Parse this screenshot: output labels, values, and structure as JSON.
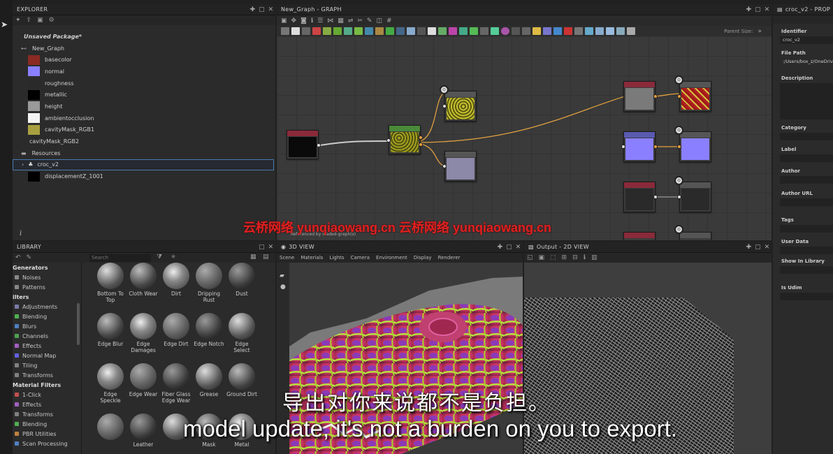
{
  "explorer": {
    "title": "EXPLORER",
    "package": "Unsaved Package*",
    "graph": "New_Graph",
    "outputs": [
      {
        "label": "basecolor",
        "color": "#8a2a22"
      },
      {
        "label": "normal",
        "color": "#8a80ff"
      },
      {
        "label": "roughness",
        "color": "#2a2a2a"
      },
      {
        "label": "metallic",
        "color": "#000000"
      },
      {
        "label": "height",
        "color": "#9a9a9a"
      },
      {
        "label": "ambientocclusion",
        "color": "#f4f4f4"
      },
      {
        "label": "cavityMask_RGB1",
        "color": "#a8a040"
      }
    ],
    "cavity2": "cavityMask_RGB2",
    "resources": "Resources",
    "croc": "croc_v2",
    "displacement": "displacementZ_1001"
  },
  "graph": {
    "title": "New_Graph - GRAPH",
    "parent_size": "Parent Size:",
    "referenced": "Referenced by loaded-graph(s)"
  },
  "library": {
    "title": "LIBRARY",
    "search_placeholder": "Search",
    "categories": [
      {
        "label": "Generators",
        "header": true,
        "color": ""
      },
      {
        "label": "Noises",
        "header": false,
        "color": "#888"
      },
      {
        "label": "Patterns",
        "header": false,
        "color": "#888"
      },
      {
        "label": "ilters",
        "header": true,
        "color": ""
      },
      {
        "label": "Adjustments",
        "header": false,
        "color": "#7a7aa8"
      },
      {
        "label": "Blending",
        "header": false,
        "color": "#50b050"
      },
      {
        "label": "Blurs",
        "header": false,
        "color": "#5080c0"
      },
      {
        "label": "Channels",
        "header": false,
        "color": "#50a050"
      },
      {
        "label": "Effects",
        "header": false,
        "color": "#a060c0"
      },
      {
        "label": "Normal Map",
        "header": false,
        "color": "#6060e0"
      },
      {
        "label": "Tiling",
        "header": false,
        "color": "#808080"
      },
      {
        "label": "Transforms",
        "header": false,
        "color": "#808080"
      },
      {
        "label": "Material Filters",
        "header": true,
        "color": ""
      },
      {
        "label": "1-Click",
        "header": false,
        "color": "#c05050"
      },
      {
        "label": "Effects",
        "header": false,
        "color": "#a060c0"
      },
      {
        "label": "Transforms",
        "header": false,
        "color": "#808080"
      },
      {
        "label": "Blending",
        "header": false,
        "color": "#50b050"
      },
      {
        "label": "PBR Utilities",
        "header": false,
        "color": "#c08040"
      },
      {
        "label": "Scan Processing",
        "header": false,
        "color": "#5080c0"
      }
    ],
    "items": [
      {
        "label": "Bottom To Top"
      },
      {
        "label": "Cloth Wear"
      },
      {
        "label": "Dirt"
      },
      {
        "label": "Dripping Rust"
      },
      {
        "label": "Dust"
      },
      {
        "label": "Edge Blur"
      },
      {
        "label": "Edge Damages"
      },
      {
        "label": "Edge Dirt"
      },
      {
        "label": "Edge Notch"
      },
      {
        "label": "Edge Select"
      },
      {
        "label": "Edge Speckle"
      },
      {
        "label": "Edge Wear"
      },
      {
        "label": "Fiber Glass Edge Wear"
      },
      {
        "label": "Grease"
      },
      {
        "label": "Ground Dirt"
      },
      {
        "label": ""
      },
      {
        "label": "Leather"
      },
      {
        "label": ""
      },
      {
        "label": "Mask"
      },
      {
        "label": "Metal"
      }
    ]
  },
  "view3d": {
    "title": "3D VIEW",
    "menu": [
      "Scene",
      "Materials",
      "Lights",
      "Camera",
      "Environment",
      "Display",
      "Renderer"
    ]
  },
  "view2d": {
    "title": "Output - 2D VIEW"
  },
  "properties": {
    "title": "croc_v2 - PROP",
    "identifier_label": "Identifier",
    "identifier": "croc_v2",
    "filepath_label": "File Path",
    "filepath": ":/Users/box_z/OneDriv",
    "fields": [
      "Description",
      "Category",
      "Label",
      "Author",
      "Author URL",
      "Tags",
      "User Data",
      "Show In Library",
      "Is Udim"
    ]
  },
  "watermark": {
    "text": "云桥网络 yunqiaowang.cn 云桥网络 yunqiaowang.cn"
  },
  "subtitle": {
    "zh": "导出对你来说都不是负担。",
    "en": "model update, it's not a burden on you to export."
  }
}
